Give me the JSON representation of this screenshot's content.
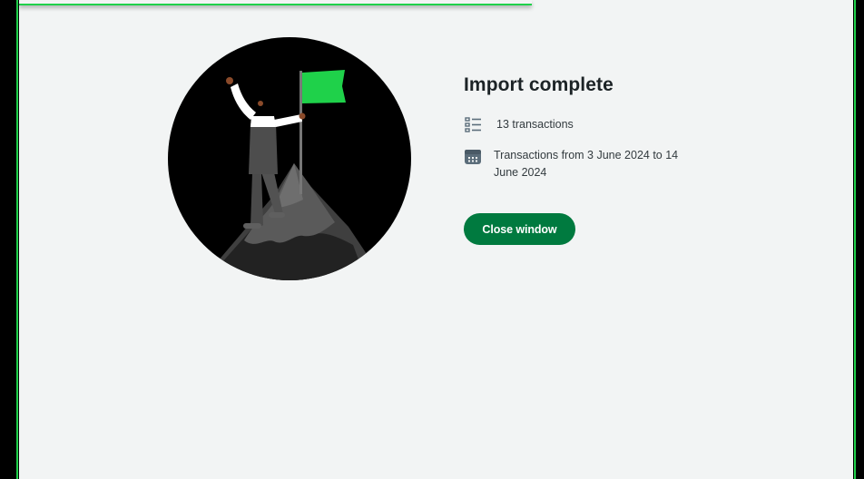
{
  "import_result": {
    "title": "Import complete",
    "transaction_count": "13 transactions",
    "date_range": "Transactions from 3 June 2024 to 14 June 2024",
    "close_label": "Close window"
  },
  "icons": {
    "list": "list-icon",
    "calendar": "calendar-icon",
    "illustration": "summit-flag-illustration"
  },
  "colors": {
    "accent": "#007a3f",
    "flag": "#1fd14a",
    "background": "#f2f4f4",
    "icon": "#5b6d7a"
  }
}
